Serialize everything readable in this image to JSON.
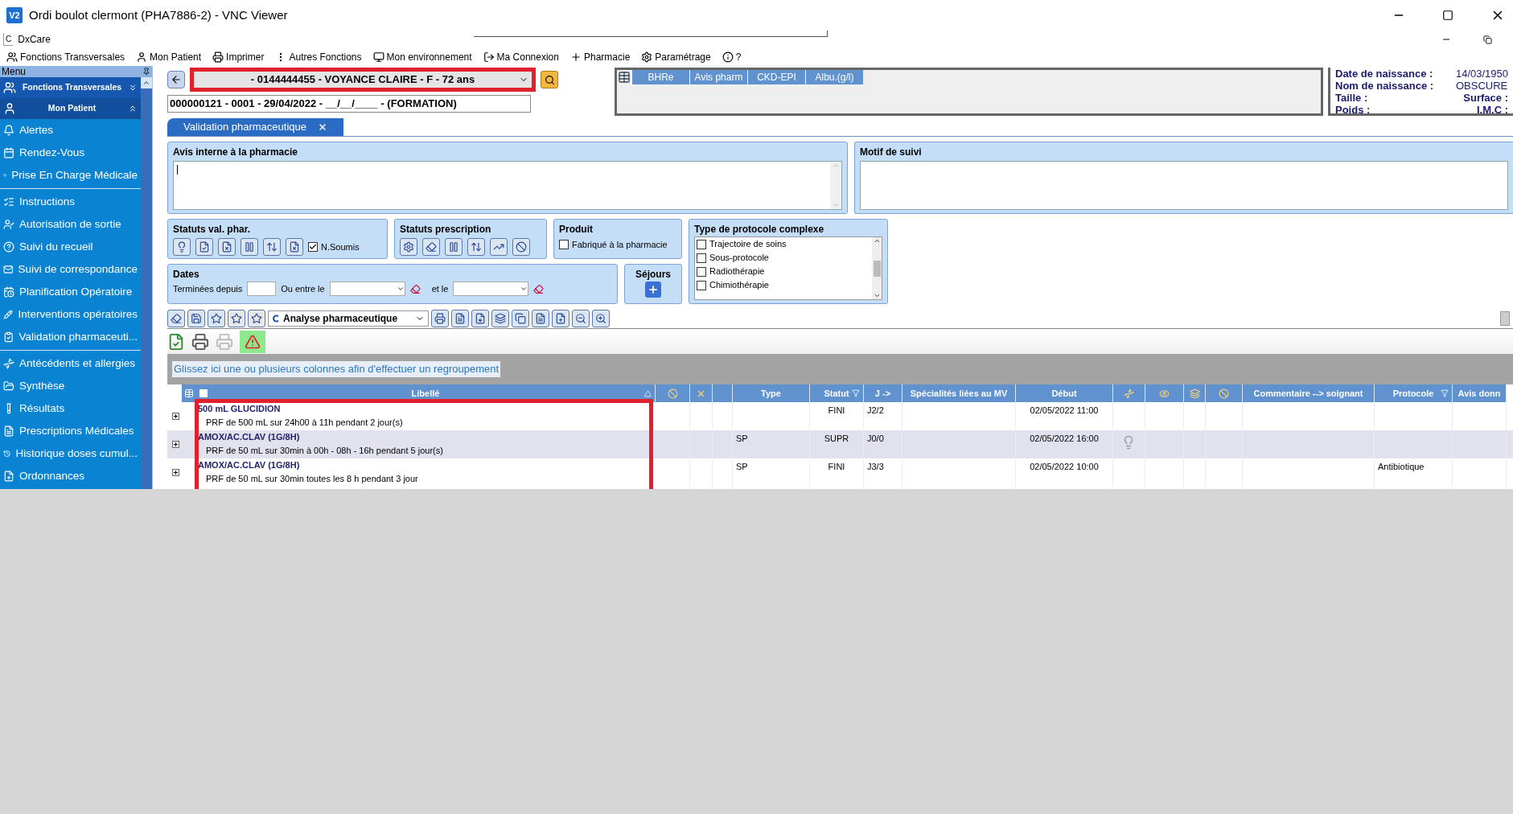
{
  "window": {
    "title": "Ordi boulot clermont (PHA7886-2) - VNC Viewer",
    "logo": "V2"
  },
  "app": {
    "name": "DxCare",
    "logo": "C"
  },
  "menu_bar": [
    "Fonctions Transversales",
    "Mon Patient",
    "Imprimer",
    "Autres Fonctions",
    "Mon environnement",
    "Ma Connexion",
    "Pharmacie",
    "Paramétrage",
    "?"
  ],
  "sidebar": {
    "title": "Menu",
    "sections": [
      {
        "label": "Fonctions Transversales",
        "expanded": false
      },
      {
        "label": "Mon Patient",
        "expanded": true
      }
    ],
    "groups": [
      [
        "Alertes",
        "Rendez-Vous",
        "Prise En Charge Médicale"
      ],
      [
        "Instructions",
        "Autorisation de sortie",
        "Suivi du recueil",
        "Suivi de correspondance",
        "Planification Opératoire",
        "Interventions opératoires",
        "Validation  pharmaceuti..."
      ],
      [
        "Antécédents et allergies",
        "Synthèse",
        "Résultats",
        "Prescriptions Médicales",
        "Historique  doses  cumul...",
        "Ordonnances"
      ]
    ]
  },
  "patient": {
    "selector": "- 0144444455 - VOYANCE CLAIRE - F - 72 ans",
    "stay": "000000121 - 0001 - 29/04/2022 - __/__/____ - (FORMATION)"
  },
  "lab_tabs": [
    "BHRe",
    "Avis pharm",
    "CKD-EPI",
    "Albu.(g/l)"
  ],
  "patient_info": [
    {
      "label": "Date de naissance :",
      "value": "14/03/1950"
    },
    {
      "label": "Nom de naissance :",
      "value": "OBSCURE"
    },
    {
      "label": "Taille :",
      "label2": "Surface :"
    },
    {
      "label": "Poids :",
      "label2": "I.M.C :"
    }
  ],
  "tabs": [
    {
      "label": "Validation pharmaceutique",
      "selected": true
    }
  ],
  "avis_panel": {
    "title": "Avis interne à la pharmacie"
  },
  "motif_panel": {
    "title": "Motif de suivi"
  },
  "statuts_val": {
    "title": "Statuts val. phar.",
    "checkbox": {
      "label": "N.Soumis",
      "checked": true
    }
  },
  "statuts_prescription": {
    "title": "Statuts prescription"
  },
  "produit": {
    "title": "Produit",
    "checkbox": {
      "label": "Fabriqué à la pharmacie",
      "checked": false
    }
  },
  "protocole": {
    "title": "Type de protocole complexe",
    "options": [
      {
        "label": "Trajectoire de soins",
        "checked": false
      },
      {
        "label": "Sous-protocole",
        "checked": false
      },
      {
        "label": "Radiothérapie",
        "checked": false
      },
      {
        "label": "Chimiothérapie",
        "checked": false
      }
    ]
  },
  "dates": {
    "title": "Dates",
    "since_label": "Terminées depuis",
    "between_label": "Ou entre le",
    "and_label": "et le"
  },
  "sejours": {
    "title": "Séjours"
  },
  "analysis_select": {
    "value": "Analyse pharmaceutique"
  },
  "group_hint": "Glissez ici une ou plusieurs colonnes afin d'effectuer un regroupement",
  "table": {
    "select_all_checked": false,
    "columns": [
      {
        "label": "Libellé",
        "kind": "text"
      },
      {
        "kind": "icon"
      },
      {
        "kind": "icon"
      },
      {
        "kind": "icon"
      },
      {
        "label": "Type",
        "kind": "text"
      },
      {
        "label": "Statut",
        "kind": "filter"
      },
      {
        "label": "J ->",
        "kind": "text"
      },
      {
        "label": "Spécialités liées au MV",
        "kind": "text"
      },
      {
        "label": "Début",
        "kind": "text"
      },
      {
        "kind": "icon"
      },
      {
        "kind": "icon"
      },
      {
        "kind": "icon"
      },
      {
        "kind": "icon"
      },
      {
        "label": "Commentaire --> soignant",
        "kind": "text"
      },
      {
        "label": "Protocole",
        "kind": "filter"
      },
      {
        "label": "Avis donn",
        "kind": "text"
      }
    ],
    "rows": [
      {
        "name": "500 mL GLUCIDION",
        "detail": "PRF de 500 mL sur 24h00 à 11h pendant 2 jour(s)",
        "statut": "FINI",
        "j": "J2/2",
        "debut": "02/05/2022 11:00",
        "hint": false
      },
      {
        "name": "AMOX/AC.CLAV (1G/8H)",
        "detail": "PRF de 50 mL sur 30min à 00h - 08h - 16h pendant 5 jour(s)",
        "type": "SP",
        "statut": "SUPR",
        "j": "J0/0",
        "debut": "02/05/2022 16:00",
        "hint": true
      },
      {
        "name": "AMOX/AC.CLAV (1G/8H)",
        "detail": "PRF de 50 mL sur 30min toutes les 8 h pendant 3 jour",
        "type": "SP",
        "statut": "FINI",
        "j": "J3/3",
        "debut": "02/05/2022 10:00",
        "protocole": "Antibiotique",
        "hint": false
      }
    ]
  }
}
